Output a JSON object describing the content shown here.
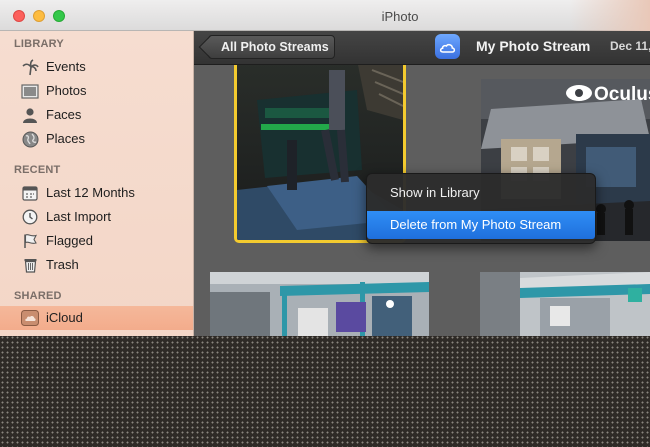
{
  "window": {
    "title": "iPhoto"
  },
  "sidebar": {
    "sections": [
      {
        "heading": "LIBRARY",
        "items": [
          {
            "label": "Events",
            "icon": "palm-tree-icon"
          },
          {
            "label": "Photos",
            "icon": "photos-icon"
          },
          {
            "label": "Faces",
            "icon": "faces-icon"
          },
          {
            "label": "Places",
            "icon": "globe-icon"
          }
        ]
      },
      {
        "heading": "RECENT",
        "items": [
          {
            "label": "Last 12 Months",
            "icon": "calendar-icon"
          },
          {
            "label": "Last Import",
            "icon": "clock-icon"
          },
          {
            "label": "Flagged",
            "icon": "flag-icon"
          },
          {
            "label": "Trash",
            "icon": "trash-icon"
          }
        ]
      },
      {
        "heading": "SHARED",
        "items": [
          {
            "label": "iCloud",
            "icon": "icloud-icon",
            "selected": true
          }
        ]
      }
    ]
  },
  "toolbar": {
    "back_label": "All Photo Streams",
    "stream_title": "My Photo Stream",
    "date": "Dec 11,"
  },
  "context_menu": {
    "items": [
      {
        "label": "Show in Library",
        "highlighted": false
      },
      {
        "label": "Delete from My Photo Stream",
        "highlighted": true
      }
    ]
  },
  "photos": {
    "overlay_text": "Oculus"
  },
  "colors": {
    "selection_border": "#f4cb2f",
    "menu_highlight": "#2478ea",
    "sidebar_selected": "#f3ac8c",
    "sidebar_bg": "#f4d8ca"
  }
}
